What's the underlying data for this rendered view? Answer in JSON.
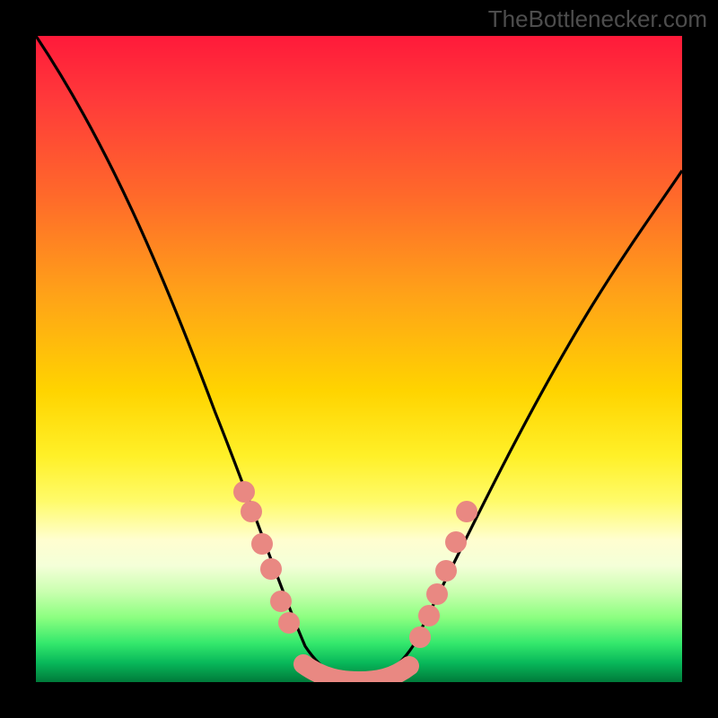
{
  "watermark": {
    "text": "TheBottlenecker.com"
  },
  "chart_data": {
    "type": "line",
    "title": "",
    "xlabel": "",
    "ylabel": "",
    "xlim": [
      0,
      100
    ],
    "ylim": [
      0,
      100
    ],
    "background_gradient": [
      "#ff1a3a",
      "#ff6a2a",
      "#ffd400",
      "#fffb6a",
      "#caffb0",
      "#08b85a"
    ],
    "series": [
      {
        "name": "bottleneck-curve",
        "type": "line",
        "color": "#000000",
        "x": [
          0,
          5,
          10,
          15,
          20,
          25,
          30,
          35,
          38,
          40,
          42,
          45,
          48,
          50,
          52,
          55,
          60,
          65,
          70,
          75,
          80,
          85,
          90,
          95,
          100
        ],
        "y": [
          100,
          92,
          82,
          71,
          60,
          48,
          36,
          24,
          16,
          10,
          5,
          1,
          0,
          0,
          0,
          1,
          6,
          15,
          24,
          32,
          40,
          47,
          54,
          60,
          66
        ]
      },
      {
        "name": "left-dots",
        "type": "scatter",
        "color": "#e98882",
        "x": [
          32.0,
          33.2,
          35.0,
          36.2,
          37.8,
          39.0
        ],
        "y": [
          30,
          27,
          21,
          17.5,
          12.5,
          9
        ]
      },
      {
        "name": "right-dots",
        "type": "scatter",
        "color": "#e98882",
        "x": [
          56.0,
          57.3,
          58.6,
          60.0,
          61.5,
          63.2
        ],
        "y": [
          7.5,
          11,
          14.5,
          18,
          22.5,
          27
        ]
      },
      {
        "name": "bottom-band",
        "type": "line",
        "color": "#e98882",
        "stroke_width": 14,
        "x": [
          41,
          44,
          47,
          50,
          53
        ],
        "y": [
          2,
          0.3,
          0,
          0.3,
          2
        ]
      }
    ]
  }
}
